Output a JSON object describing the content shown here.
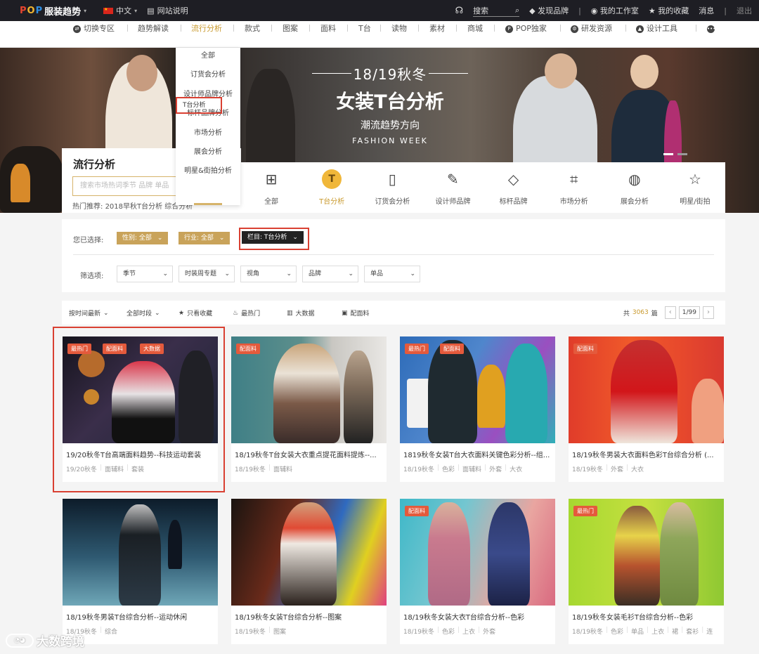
{
  "topbar": {
    "logo_pop": [
      "P",
      "O",
      "P"
    ],
    "logo_text": "服装趋势",
    "language": "中文",
    "site_guide": "网站说明",
    "search_label": "搜索",
    "discover_brand": "发现品牌",
    "workspace": "我的工作室",
    "favorites": "我的收藏",
    "messages": "消息",
    "logout": "退出"
  },
  "nav": {
    "items": [
      "切换专区",
      "趋势解读",
      "流行分析",
      "款式",
      "图案",
      "面料",
      "T台",
      "读物",
      "素材",
      "商城",
      "POP独家",
      "研发资源",
      "设计工具"
    ],
    "active": "流行分析"
  },
  "hero": {
    "line1": "18/19秋冬",
    "line2": "女装T台分析",
    "line3": "潮流趋势方向",
    "line4": "FASHION WEEK"
  },
  "flow_panel": {
    "title": "流行分析",
    "search_placeholder": "搜索市场热词季节 品牌 单品",
    "hot_prefix": "热门推荐:",
    "hot_items": "2018早秋T台分析   综合分析"
  },
  "dropdown": {
    "options": [
      "全部",
      "T台分析",
      "订货会分析",
      "设计师品牌分析",
      "标杆品牌分析",
      "市场分析",
      "展会分析",
      "明星&街拍分析"
    ],
    "selected": "T台分析"
  },
  "categories": [
    {
      "label": "全部",
      "icon": "grid-icon"
    },
    {
      "label": "T台分析",
      "icon": "t-icon"
    },
    {
      "label": "订货会分析",
      "icon": "document-icon"
    },
    {
      "label": "设计师品牌",
      "icon": "pencil-ruler-icon"
    },
    {
      "label": "标杆品牌",
      "icon": "diamond-icon"
    },
    {
      "label": "市场分析",
      "icon": "chart-icon"
    },
    {
      "label": "展会分析",
      "icon": "globe-icon"
    },
    {
      "label": "明星/街拍",
      "icon": "star-icon"
    }
  ],
  "filter": {
    "selected_label": "您已选择:",
    "chip_gender": "性别: 全部",
    "chip_industry": "行业: 全部",
    "chip_column": "栏目: T台分析",
    "options_label": "筛选项:",
    "selects": [
      "季节",
      "时装周专题",
      "视角",
      "品牌",
      "单品"
    ]
  },
  "sortbar": {
    "sort_time": "按时间最新",
    "period": "全部时段",
    "only_fav": "只看收藏",
    "most_popular": "最热门",
    "big_data": "大数据",
    "fabric": "配面料",
    "total_prefix": "共",
    "total_count": "3063",
    "total_suffix": "篇",
    "page": "1/99"
  },
  "cards": [
    {
      "title": "19/20秋冬T台高端面料趋势--科技运动套装",
      "tags": [
        "19/20秋冬",
        "面辅料",
        "套装"
      ],
      "badges": [
        "最热门",
        "配面料",
        "大数据"
      ]
    },
    {
      "title": "18/19秋冬T台女装大衣重点提花面料提炼--...",
      "tags": [
        "18/19秋冬",
        "面辅料"
      ],
      "badges": [
        "配面料"
      ]
    },
    {
      "title": "1819秋冬女装T台大衣面料关键色彩分析--组...",
      "tags": [
        "18/19秋冬",
        "色彩",
        "面辅料",
        "外套",
        "大衣"
      ],
      "badges": [
        "最热门",
        "配面料"
      ]
    },
    {
      "title": "18/19秋冬男装大衣面料色彩T台综合分析 (...",
      "tags": [
        "18/19秋冬",
        "外套",
        "大衣"
      ],
      "badges": [
        "配面料"
      ]
    },
    {
      "title": "18/19秋冬男装T台综合分析--运动休闲",
      "tags": [
        "18/19秋冬",
        "综合"
      ],
      "badges": []
    },
    {
      "title": "18/19秋冬女装T台综合分析--图案",
      "tags": [
        "18/19秋冬",
        "图案"
      ],
      "badges": []
    },
    {
      "title": "18/19秋冬女装大衣T台综合分析--色彩",
      "tags": [
        "18/19秋冬",
        "色彩",
        "上衣",
        "外套"
      ],
      "badges": [
        "配面料"
      ]
    },
    {
      "title": "18/19秋冬女装毛衫T台综合分析--色彩",
      "tags": [
        "18/19秋冬",
        "色彩",
        "单品",
        "上衣",
        "裙",
        "套衫",
        "连"
      ],
      "badges": [
        "最热门"
      ]
    }
  ],
  "watermark": "大数跨境",
  "colors": {
    "accent": "#c99a2e",
    "highlight_box": "#d94032",
    "badge": "#e45a3c",
    "topbar": "#1e1e24"
  }
}
